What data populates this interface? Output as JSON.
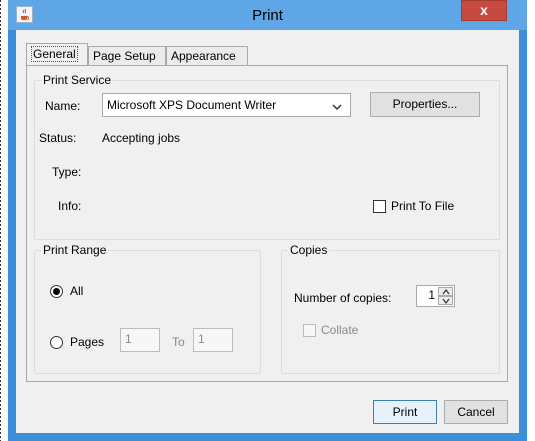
{
  "window": {
    "title": "Print",
    "close_glyph": "x"
  },
  "tabs": [
    {
      "label": "General",
      "active": true
    },
    {
      "label": "Page Setup",
      "active": false
    },
    {
      "label": "Appearance",
      "active": false
    }
  ],
  "print_service": {
    "group_title": "Print Service",
    "name_label": "Name:",
    "name_value": "Microsoft XPS Document Writer",
    "properties_button": "Properties...",
    "status_label": "Status:",
    "status_value": "Accepting jobs",
    "type_label": "Type:",
    "type_value": "",
    "info_label": "Info:",
    "info_value": "",
    "print_to_file_label": "Print To File",
    "print_to_file_checked": false
  },
  "print_range": {
    "group_title": "Print Range",
    "all_label": "All",
    "all_selected": true,
    "pages_label": "Pages",
    "from_value": "1",
    "to_label": "To",
    "to_value": "1"
  },
  "copies": {
    "group_title": "Copies",
    "number_label": "Number of copies:",
    "number_value": "1",
    "collate_label": "Collate",
    "collate_enabled": false
  },
  "buttons": {
    "print": "Print",
    "cancel": "Cancel"
  },
  "colors": {
    "window_frame": "#3a8fd8",
    "titlebar": "#5ea6e6",
    "close_button": "#c74a40",
    "dialog_background": "#f0f0f0"
  },
  "icons": {
    "app": "java-cup-icon",
    "combo_arrow": "chevron-down-icon",
    "spin_up": "spinner-up-icon",
    "spin_down": "spinner-down-icon"
  }
}
